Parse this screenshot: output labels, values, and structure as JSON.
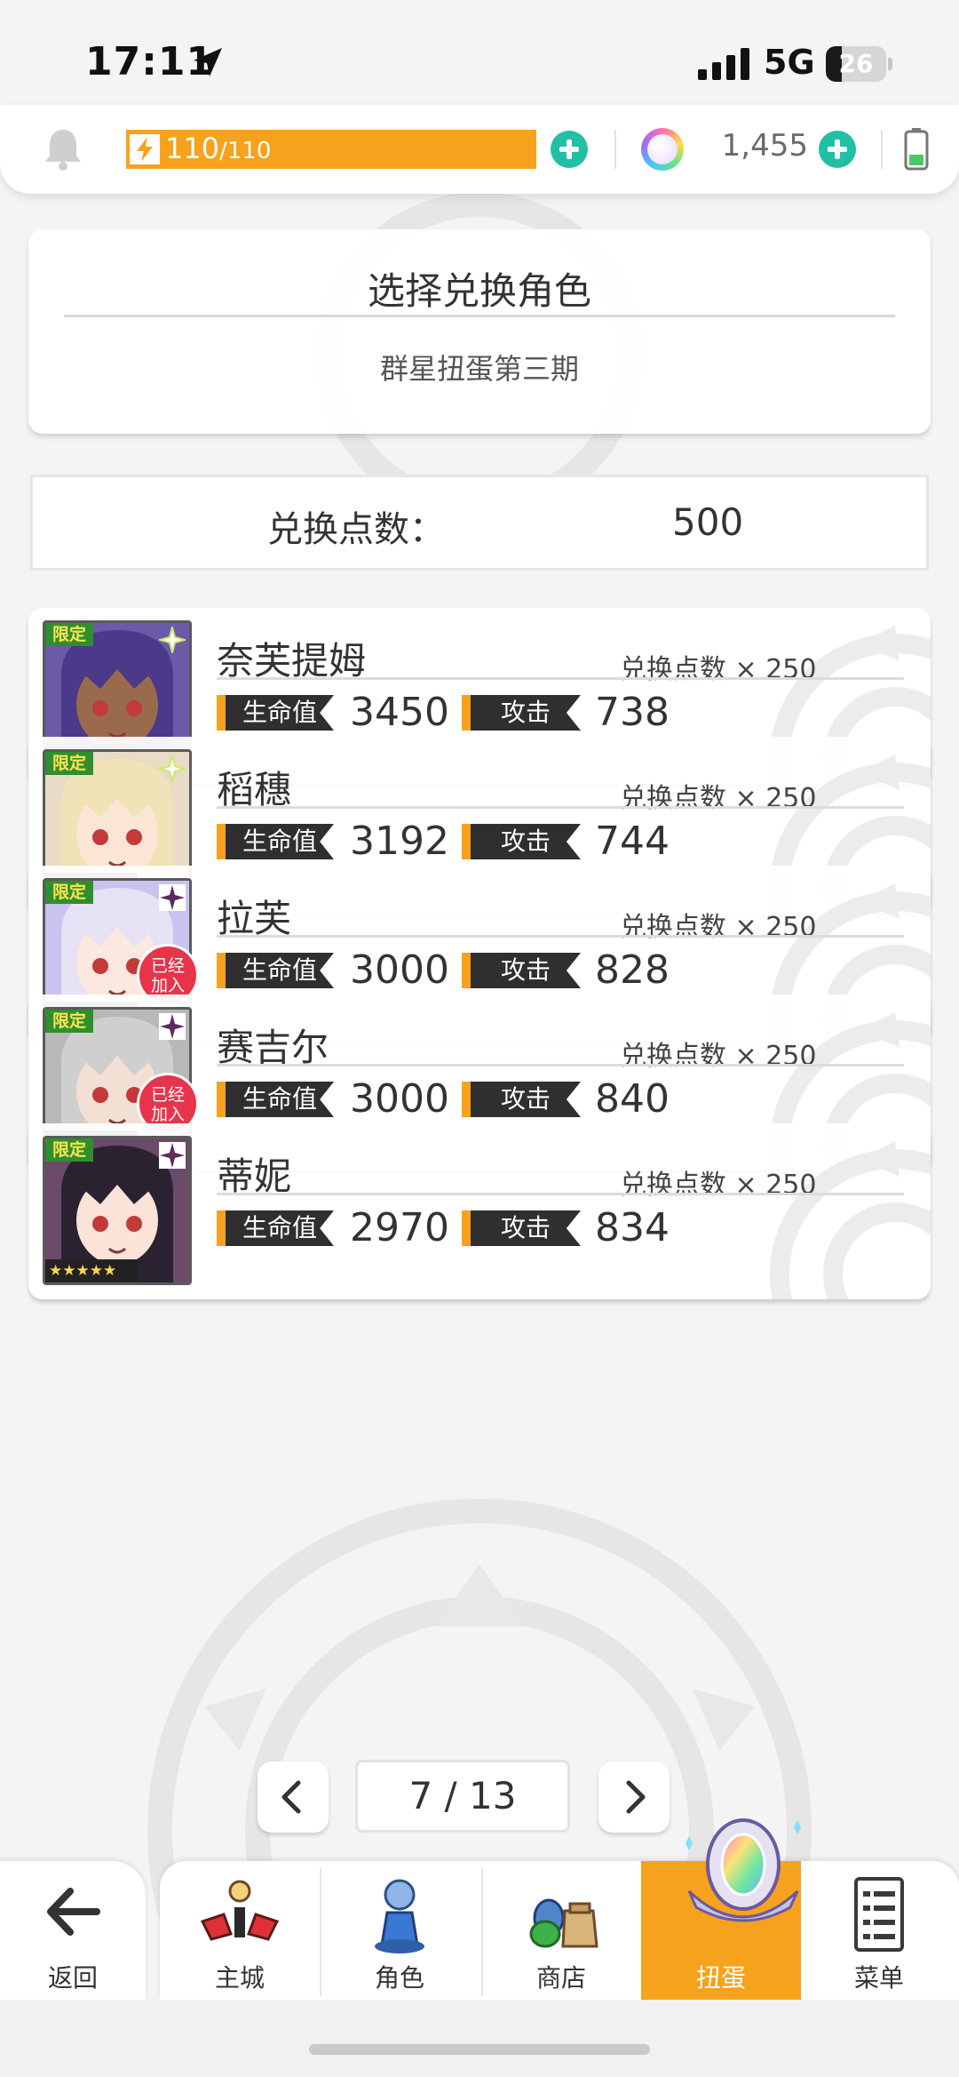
{
  "status_bar": {
    "time": "17:11",
    "network": "5G",
    "battery": "26",
    "battery_level": 0.26
  },
  "resources": {
    "energy_current": "110",
    "energy_max": "/110",
    "gems": "1,455"
  },
  "header": {
    "title": "选择兑换角色",
    "subtitle": "群星扭蛋第三期"
  },
  "points": {
    "label": "兑换点数：",
    "value": "500"
  },
  "labels": {
    "hp": "生命值",
    "atk": "攻击",
    "limited": "限定",
    "stars": "★★★★★",
    "joined_1": "已经",
    "joined_2": "加入"
  },
  "characters": [
    {
      "name": "奈芙提姆",
      "cost": "兑换点数 × 250",
      "hp": "3450",
      "atk": "738",
      "joined": false,
      "element": "sparkle",
      "hair": "#4b3a8a",
      "skin": "#9a6a4c",
      "bg": "#6b5aa8"
    },
    {
      "name": "稻穗",
      "cost": "兑换点数 × 250",
      "hp": "3192",
      "atk": "744",
      "joined": false,
      "element": "sparkle",
      "hair": "#f1e2b8",
      "skin": "#fbe6d6",
      "bg": "#e9dcc7"
    },
    {
      "name": "拉芙",
      "cost": "兑换点数 × 250",
      "hp": "3000",
      "atk": "828",
      "joined": true,
      "element": "dark",
      "hair": "#e6e2f4",
      "skin": "#fbe8de",
      "bg": "#c9c3ef"
    },
    {
      "name": "赛吉尔",
      "cost": "兑换点数 × 250",
      "hp": "3000",
      "atk": "840",
      "joined": true,
      "element": "dark",
      "hair": "#cfcfcf",
      "skin": "#f3e0d4",
      "bg": "#b8b8b8"
    },
    {
      "name": "蒂妮",
      "cost": "兑换点数 × 250",
      "hp": "2970",
      "atk": "834",
      "joined": false,
      "element": "dark",
      "hair": "#2a2230",
      "skin": "#fbe3d8",
      "bg": "#6b4a6a"
    }
  ],
  "pagination": {
    "current": "7 / 13"
  },
  "nav": {
    "back": "返回",
    "city": "主城",
    "character": "角色",
    "shop": "商店",
    "gacha": "扭蛋",
    "menu": "菜单"
  },
  "colors": {
    "accent": "#f7a21c",
    "teal": "#21c0a5",
    "badge": "#e8344b",
    "limited": "#2f8f2f"
  }
}
